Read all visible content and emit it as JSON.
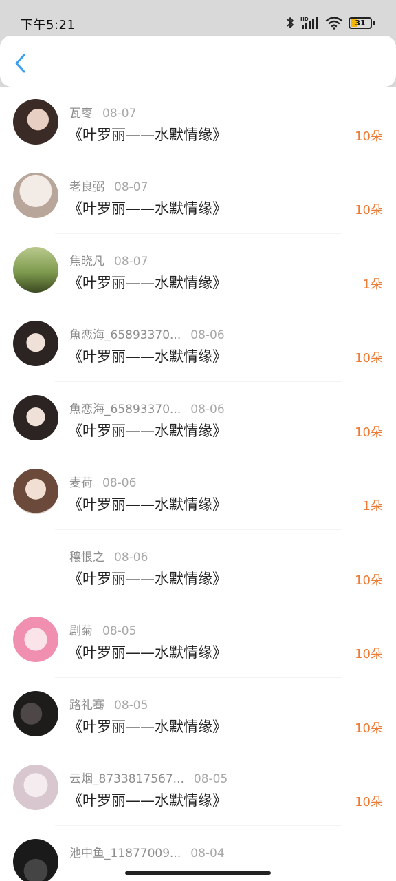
{
  "status_bar": {
    "time": "下午5:21",
    "battery_level": "31",
    "battery_percent": 31,
    "icons": [
      "bluetooth-icon",
      "hd-signal-icon",
      "wifi-icon",
      "battery-icon"
    ]
  },
  "nav": {
    "back_icon": "chevron-left-icon",
    "accent_color": "#3a9ff0"
  },
  "colors": {
    "count": "#ee7b35",
    "name": "#8e8e8e",
    "title": "#222222"
  },
  "items": [
    {
      "name": "瓦枣",
      "date": "08-07",
      "title": "《叶罗丽——水默情缘》",
      "count": "10朵",
      "avatar": "photo"
    },
    {
      "name": "老良弼",
      "date": "08-07",
      "title": "《叶罗丽——水默情缘》",
      "count": "10朵",
      "avatar": "photo"
    },
    {
      "name": "焦晓凡",
      "date": "08-07",
      "title": "《叶罗丽——水默情缘》",
      "count": "1朵",
      "avatar": "photo"
    },
    {
      "name": "魚恋海_65893370...",
      "date": "08-06",
      "title": "《叶罗丽——水默情缘》",
      "count": "10朵",
      "avatar": "photo"
    },
    {
      "name": "魚恋海_65893370...",
      "date": "08-06",
      "title": "《叶罗丽——水默情缘》",
      "count": "10朵",
      "avatar": "photo"
    },
    {
      "name": "麦荷",
      "date": "08-06",
      "title": "《叶罗丽——水默情缘》",
      "count": "1朵",
      "avatar": "photo"
    },
    {
      "name": "穰恨之",
      "date": "08-06",
      "title": "《叶罗丽——水默情缘》",
      "count": "10朵",
      "avatar": "none"
    },
    {
      "name": "剧菊",
      "date": "08-05",
      "title": "《叶罗丽——水默情缘》",
      "count": "10朵",
      "avatar": "photo"
    },
    {
      "name": "路礼骞",
      "date": "08-05",
      "title": "《叶罗丽——水默情缘》",
      "count": "10朵",
      "avatar": "photo"
    },
    {
      "name": "云烟_8733817567...",
      "date": "08-05",
      "title": "《叶罗丽——水默情缘》",
      "count": "10朵",
      "avatar": "photo"
    },
    {
      "name": "池中鱼_11877009...",
      "date": "08-04",
      "title": "",
      "count": "",
      "avatar": "photo"
    }
  ]
}
